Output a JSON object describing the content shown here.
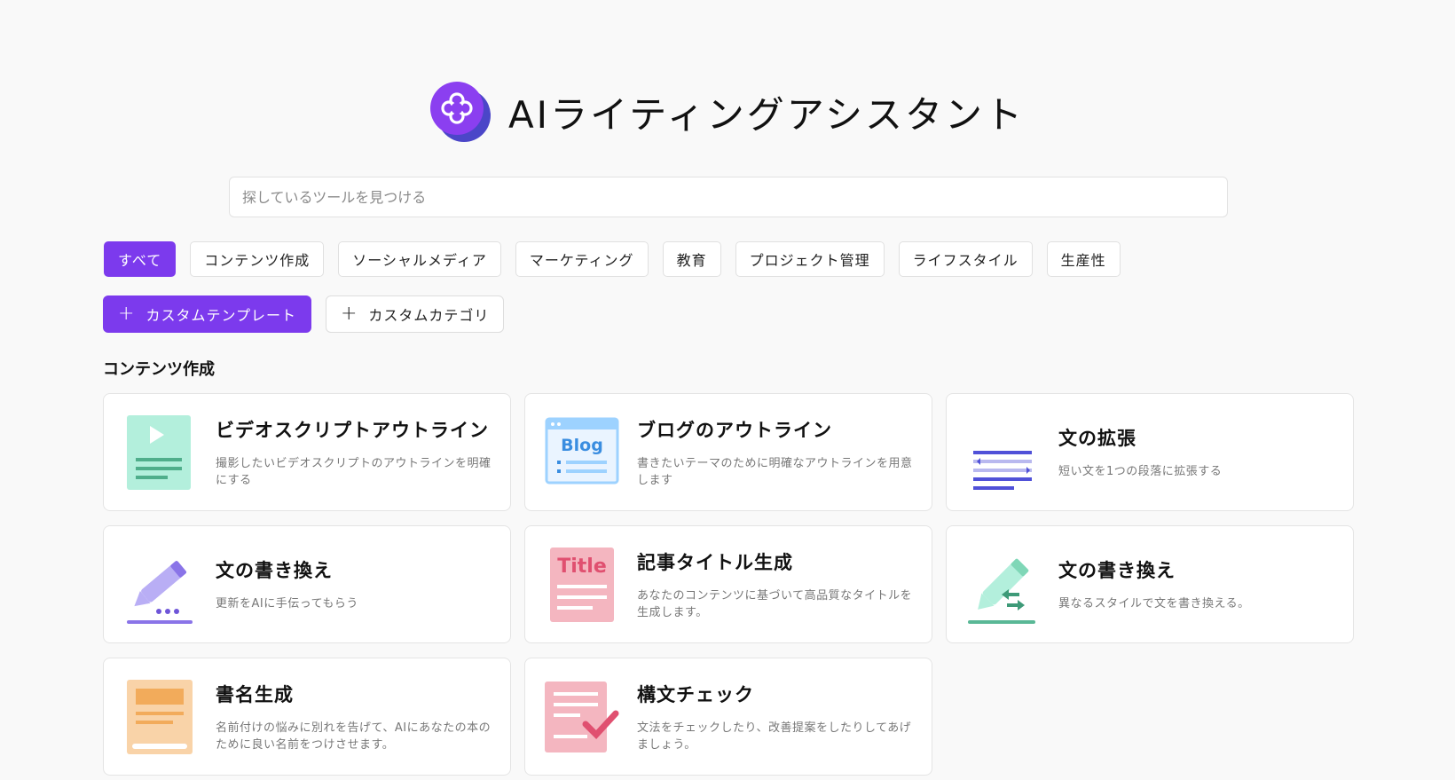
{
  "app": {
    "title": "AIライティングアシスタント"
  },
  "search": {
    "placeholder": "探しているツールを見つける",
    "value": ""
  },
  "filters": [
    {
      "label": "すべて",
      "active": true
    },
    {
      "label": "コンテンツ作成"
    },
    {
      "label": "ソーシャルメディア"
    },
    {
      "label": "マーケティング"
    },
    {
      "label": "教育"
    },
    {
      "label": "プロジェクト管理"
    },
    {
      "label": "ライフスタイル"
    },
    {
      "label": "生産性"
    }
  ],
  "actions": {
    "custom_template": "カスタムテンプレート",
    "custom_category": "カスタムカテゴリ"
  },
  "section": {
    "title": "コンテンツ作成"
  },
  "cards": [
    {
      "title": "ビデオスクリプトアウトライン",
      "desc": "撮影したいビデオスクリプトのアウトラインを明確にする",
      "icon": "video-script-icon"
    },
    {
      "title": "ブログのアウトライン",
      "desc": "書きたいテーマのために明確なアウトラインを用意します",
      "icon": "blog-icon",
      "icon_text": "Blog"
    },
    {
      "title": "文の拡張",
      "desc": "短い文を1つの段落に拡張する",
      "icon": "text-expand-icon"
    },
    {
      "title": "文の書き換え",
      "desc": "更新をAIに手伝ってもらう",
      "icon": "pencil-icon"
    },
    {
      "title": "記事タイトル生成",
      "desc": "あなたのコンテンツに基づいて高品質なタイトルを生成します。",
      "icon": "title-icon",
      "icon_text": "Title"
    },
    {
      "title": "文の書き換え",
      "desc": "異なるスタイルで文を書き換える。",
      "icon": "pencil-swap-icon"
    },
    {
      "title": "書名生成",
      "desc": "名前付けの悩みに別れを告げて、AIにあなたの本のために良い名前をつけさせます。",
      "icon": "book-title-icon"
    },
    {
      "title": "構文チェック",
      "desc": "文法をチェックしたり、改善提案をしたりしてあげましょう。",
      "icon": "syntax-check-icon"
    }
  ],
  "colors": {
    "accent": "#7c3aed"
  }
}
